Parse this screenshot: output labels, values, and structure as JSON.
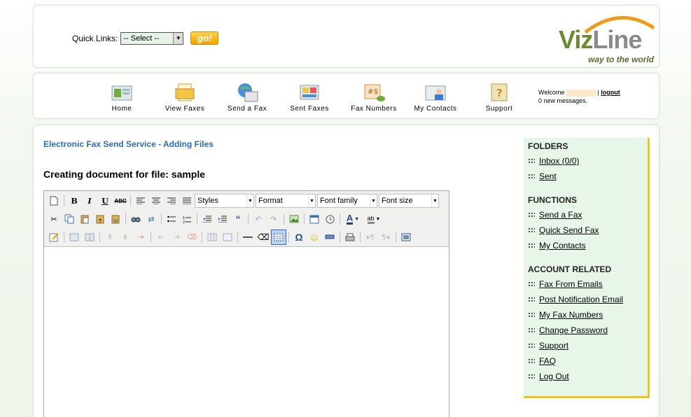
{
  "header": {
    "quick_links_label": "Quick Links:",
    "quick_links_select": "-- Select --",
    "go_label": "go!",
    "logo": {
      "brand_viz": "Viz",
      "brand_line": "Line",
      "tagline": "way to the world"
    }
  },
  "nav": {
    "items": [
      {
        "label": "Home",
        "icon": "home-icon"
      },
      {
        "label": "View Faxes",
        "icon": "view-faxes-icon"
      },
      {
        "label": "Send a Fax",
        "icon": "send-fax-icon"
      },
      {
        "label": "Sent Faxes",
        "icon": "sent-faxes-icon"
      },
      {
        "label": "Fax Numbers",
        "icon": "fax-numbers-icon"
      },
      {
        "label": "My Contacts",
        "icon": "contacts-icon"
      },
      {
        "label": "Support",
        "icon": "support-icon"
      }
    ],
    "welcome_label": "Welcome",
    "logout_label": "logout",
    "messages": "0 new messages."
  },
  "main": {
    "page_title": "Electronic Fax Send Service - Adding Files",
    "doc_title": "Creating document for file: sample",
    "editor": {
      "styles": "Styles",
      "format": "Format",
      "font_family": "Font family",
      "font_size": "Font size"
    }
  },
  "sidebar": {
    "folders_head": "FOLDERS",
    "folders": [
      "Inbox (0/0)",
      "Sent"
    ],
    "functions_head": "FUNCTIONS",
    "functions": [
      "Send a Fax",
      "Quick Send Fax",
      "My Contacts"
    ],
    "account_head": "ACCOUNT RELATED",
    "account": [
      "Fax From Emails",
      "Post Notification Email",
      "My Fax Numbers",
      "Change Password",
      "Support",
      "FAQ",
      "Log Out"
    ]
  },
  "colors": {
    "accent_blue": "#2a6db3",
    "sidebar_bg": "#e8f5e9",
    "sidebar_border": "#f2c318",
    "logo_green": "#6a8b32"
  }
}
